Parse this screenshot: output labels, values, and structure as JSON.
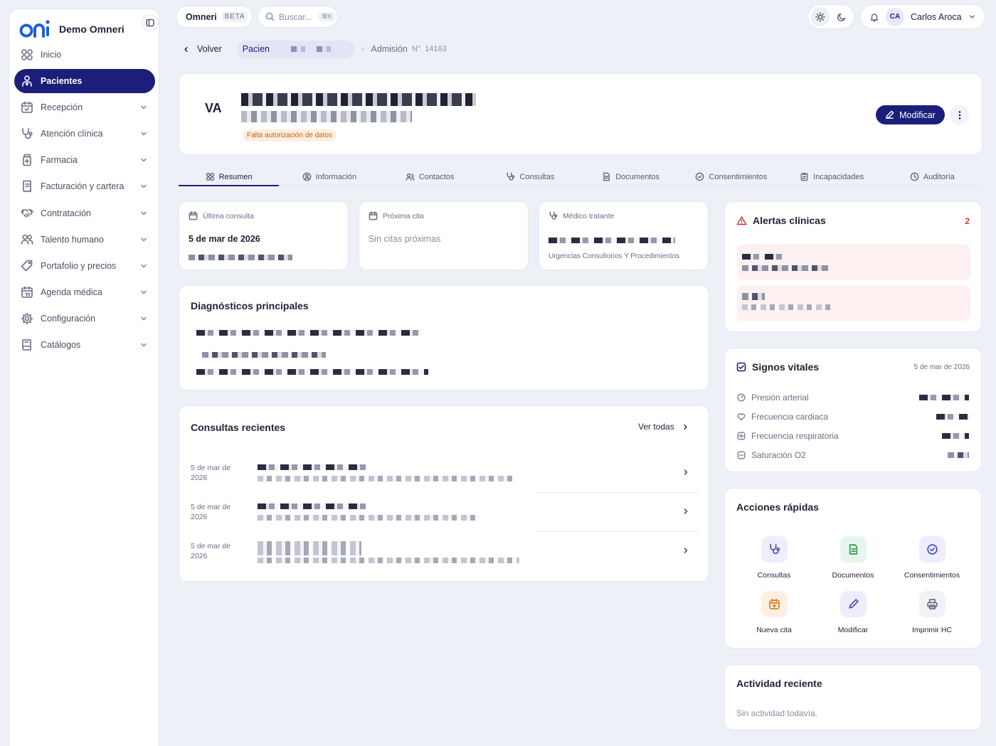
{
  "app": {
    "brand": "Demo Omneri",
    "name": "Omneri",
    "badge": "BETA"
  },
  "search": {
    "placeholder": "Buscar...",
    "shortcut": "⌘K"
  },
  "user": {
    "initials": "CA",
    "name": "Carlos Aroca"
  },
  "sidebar": {
    "items": [
      {
        "label": "Inicio",
        "icon": "grid-icon",
        "expandable": false,
        "active": false
      },
      {
        "label": "Pacientes",
        "icon": "patients-icon",
        "expandable": false,
        "active": true
      },
      {
        "label": "Recepción",
        "icon": "calendar-check-icon",
        "expandable": true,
        "active": false
      },
      {
        "label": "Atención clínica",
        "icon": "stethoscope-icon",
        "expandable": true,
        "active": false
      },
      {
        "label": "Farmacia",
        "icon": "pill-bottle-icon",
        "expandable": true,
        "active": false
      },
      {
        "label": "Facturación y cartera",
        "icon": "receipt-icon",
        "expandable": true,
        "active": false
      },
      {
        "label": "Contratación",
        "icon": "handshake-icon",
        "expandable": true,
        "active": false
      },
      {
        "label": "Talento humano",
        "icon": "users-icon",
        "expandable": true,
        "active": false
      },
      {
        "label": "Portafolio y precios",
        "icon": "tag-icon",
        "expandable": true,
        "active": false
      },
      {
        "label": "Agenda médica",
        "icon": "calendar-icon",
        "expandable": true,
        "active": false
      },
      {
        "label": "Configuración",
        "icon": "gear-icon",
        "expandable": true,
        "active": false
      },
      {
        "label": "Catálogos",
        "icon": "book-icon",
        "expandable": true,
        "active": false
      }
    ]
  },
  "breadcrumb": {
    "back": "Volver",
    "current": "Pacien",
    "admission_label": "Admisión",
    "admission_prefix": "N°",
    "admission_number": "14163"
  },
  "patient": {
    "initials": "VA",
    "warning": "Falta autorización de datos",
    "modify_label": "Modificar"
  },
  "tabs": [
    {
      "label": "Resumen",
      "icon": "grid-icon",
      "active": true
    },
    {
      "label": "Información",
      "icon": "user-circle-icon",
      "active": false
    },
    {
      "label": "Contactos",
      "icon": "contacts-icon",
      "active": false
    },
    {
      "label": "Consultas",
      "icon": "stethoscope-icon",
      "active": false
    },
    {
      "label": "Documentos",
      "icon": "document-icon",
      "active": false
    },
    {
      "label": "Consentimientos",
      "icon": "check-circle-icon",
      "active": false
    },
    {
      "label": "Incapacidades",
      "icon": "clipboard-icon",
      "active": false
    },
    {
      "label": "Auditoría",
      "icon": "history-icon",
      "active": false
    }
  ],
  "summary": {
    "last_visit": {
      "label": "Última consulta",
      "value": "5 de mar de 2026"
    },
    "next_appointment": {
      "label": "Próxima cita",
      "value": "Sin citas próximas"
    },
    "doctor": {
      "label": "Médico tratante",
      "service": "Urgencias Consultorios Y Procedimientos"
    }
  },
  "diagnoses": {
    "title": "Diagnósticos principales"
  },
  "recent_consults": {
    "title": "Consultas recientes",
    "see_all": "Ver todas",
    "rows": [
      {
        "date": "5 de mar de 2026"
      },
      {
        "date": "5 de mar de 2026"
      },
      {
        "date": "5 de mar de 2026"
      }
    ]
  },
  "alerts": {
    "title": "Alertas clínicas",
    "count": "2"
  },
  "vitals": {
    "title": "Signos vitales",
    "date": "5 de mar de 2026",
    "items": [
      {
        "label": "Presión arterial",
        "icon": "gauge-icon"
      },
      {
        "label": "Frecuencia cardiaca",
        "icon": "heart-icon"
      },
      {
        "label": "Frecuencia respiratoria",
        "icon": "lungs-icon"
      },
      {
        "label": "Saturación O2",
        "icon": "oxygen-icon"
      }
    ]
  },
  "quick_actions": {
    "title": "Acciones rápidas",
    "items": [
      {
        "label": "Consultas",
        "icon": "stethoscope-icon",
        "color": "#4a4fb5",
        "bg": "#eceefb"
      },
      {
        "label": "Documentos",
        "icon": "document-icon",
        "color": "#2f9a57",
        "bg": "#e7f6ec"
      },
      {
        "label": "Consentimientos",
        "icon": "check-circle-icon",
        "color": "#4a4fb5",
        "bg": "#eceefb"
      },
      {
        "label": "Nueva cita",
        "icon": "calendar-plus-icon",
        "color": "#d9822b",
        "bg": "#fdf0e3"
      },
      {
        "label": "Modificar",
        "icon": "pencil-icon",
        "color": "#4a4fb5",
        "bg": "#eceefb"
      },
      {
        "label": "Imprimir HC",
        "icon": "printer-icon",
        "color": "#6a6e82",
        "bg": "#f1f2f6"
      }
    ]
  },
  "activity": {
    "title": "Actividad reciente",
    "empty": "Sin actividad todavía."
  },
  "colors": {
    "primary": "#1b1f7a",
    "alert": "#d23c3c",
    "alert_bg": "#fdf0f1",
    "warning": "#c2620e",
    "warning_bg": "#fdeedf",
    "background": "#eef0f8"
  }
}
